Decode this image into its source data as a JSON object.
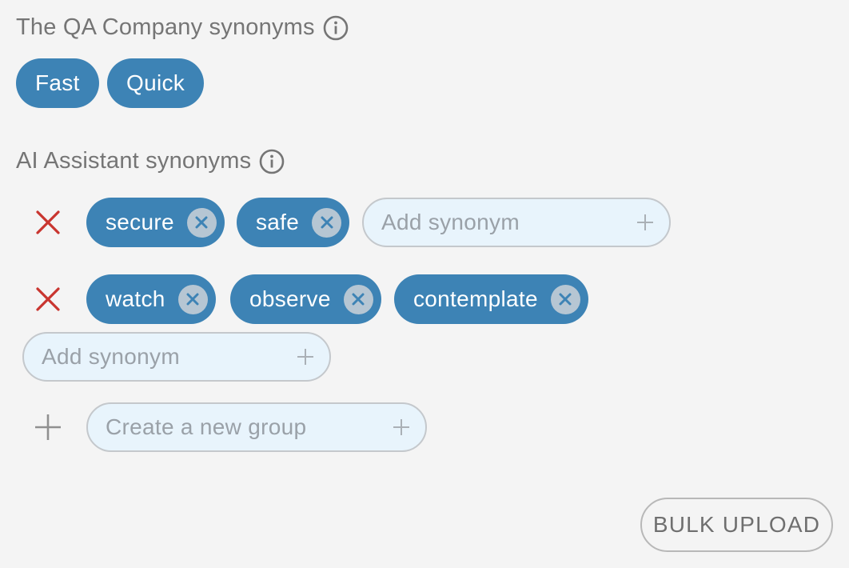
{
  "company_section": {
    "title": "The QA Company synonyms",
    "info_icon": "info-icon",
    "chips": [
      "Fast",
      "Quick"
    ]
  },
  "assistant_section": {
    "title": "AI Assistant synonyms",
    "info_icon": "info-icon",
    "groups": [
      {
        "chips": [
          "secure",
          "safe"
        ],
        "add_placeholder": "Add synonym"
      },
      {
        "chips": [
          "watch",
          "observe",
          "contemplate"
        ],
        "add_placeholder": "Add synonym"
      }
    ],
    "delete_icon": "close-icon",
    "new_group_placeholder": "Create a new group",
    "new_group_icon": "plus-icon"
  },
  "actions": {
    "bulk_upload_label": "BULK UPLOAD"
  },
  "colors": {
    "background": "#f4f4f4",
    "chip": "#3d83b5",
    "chip_text": "#ffffff",
    "delete_red": "#c9352f",
    "input_bg": "#e8f4fc",
    "input_border": "#c4c8cc"
  }
}
